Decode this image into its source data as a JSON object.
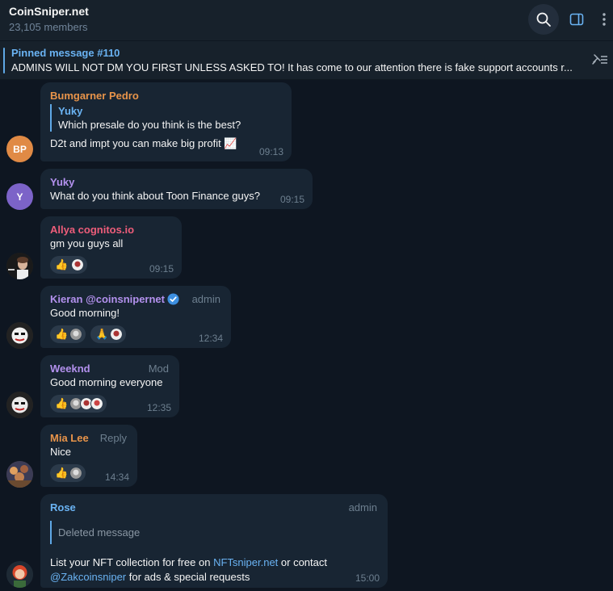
{
  "header": {
    "title": "CoinSniper.net",
    "members": "23,105 members"
  },
  "pinned": {
    "title": "Pinned message #110",
    "text": "ADMINS WILL NOT DM YOU FIRST UNLESS ASKED TO!   It has come to our attention there is fake support accounts r..."
  },
  "colors": {
    "background": "#0e1621",
    "bubble": "#182533",
    "accent": "#6ab3f3"
  },
  "messages": [
    {
      "avatar_text": "BP",
      "avatar_color": "#e08a45",
      "sender": "Bumgarner Pedro",
      "sender_color": "#e8944a",
      "reply_name": "Yuky",
      "reply_text": "Which presale do you think is the best?",
      "text": "D2t and impt you can make big profit 📈",
      "time": "09:13"
    },
    {
      "avatar_text": "Y",
      "avatar_color": "#7c63c8",
      "sender": "Yuky",
      "sender_color": "#b391ee",
      "text": "What do you think about Toon Finance guys?",
      "time": "09:15"
    },
    {
      "sender": "Allya cognitos.io",
      "sender_color": "#ee5d7a",
      "text": "gm you guys all",
      "reaction_1": "👍",
      "time": "09:15"
    },
    {
      "sender": "Kieran @coinsnipernet",
      "sender_color": "#b391ee",
      "badge": "admin",
      "text": "Good morning!",
      "reaction_1": "👍",
      "reaction_2": "🙏",
      "time": "12:34"
    },
    {
      "sender": "Weeknd",
      "sender_color": "#b391ee",
      "badge": "Mod",
      "text": "Good morning everyone",
      "reaction_1": "👍",
      "time": "12:35"
    },
    {
      "sender": "Mia Lee",
      "sender_color": "#e8944a",
      "badge": "Reply",
      "text": "Nice",
      "reaction_1": "👍",
      "time": "14:34"
    },
    {
      "sender": "Rose",
      "sender_color": "#6ab3f3",
      "badge": "admin",
      "deleted": "Deleted message",
      "text_1": "List your NFT collection for free on ",
      "link_1": "NFTsniper.net",
      "text_2": " or contact",
      "link_2": "@Zakcoinsniper",
      "text_3": " for ads & special requests",
      "time": "15:00"
    }
  ]
}
